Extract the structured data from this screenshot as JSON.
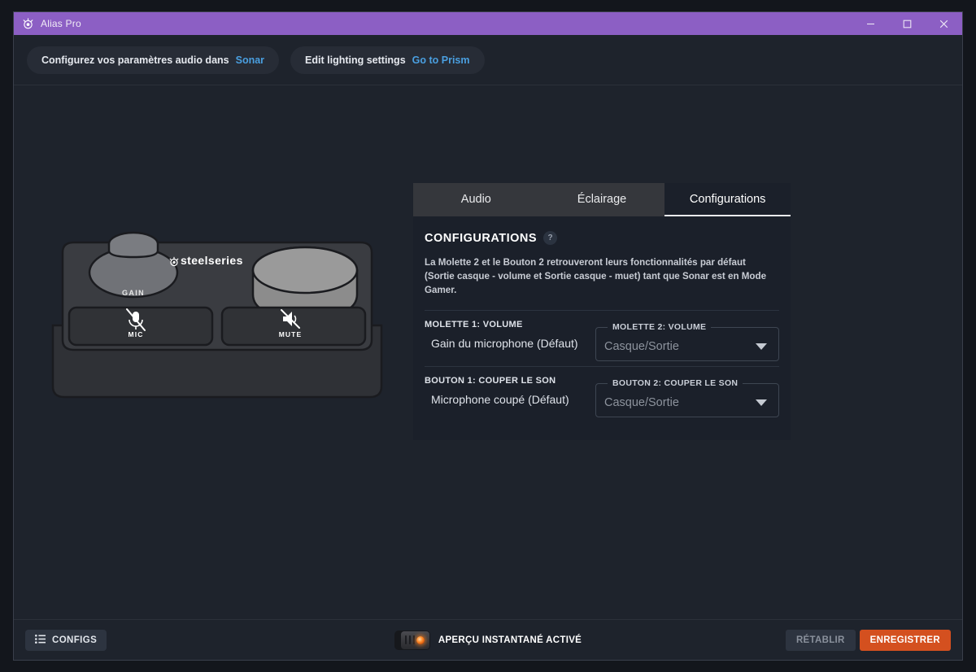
{
  "window": {
    "title": "Alias Pro",
    "logo_icon": "steelseries-logo-icon",
    "titlebar_color": "#8c5fc4",
    "controls": {
      "minimize": "minimize-icon",
      "maximize": "maximize-icon",
      "close": "close-icon"
    }
  },
  "banners": [
    {
      "text": "Configurez vos paramètres audio dans",
      "link": "Sonar"
    },
    {
      "text": "Edit lighting settings",
      "link": "Go to Prism"
    }
  ],
  "device": {
    "brand": "steelseries",
    "knob_label": "GAIN",
    "buttons": [
      {
        "label": "MIC",
        "icon": "mic-muted-icon"
      },
      {
        "label": "MUTE",
        "icon": "speaker-muted-icon"
      }
    ]
  },
  "tabs": [
    {
      "label": "Audio",
      "active": false
    },
    {
      "label": "Éclairage",
      "active": false
    },
    {
      "label": "Configurations",
      "active": true
    }
  ],
  "panel": {
    "section_title": "CONFIGURATIONS",
    "help_badge": "?",
    "description": "La Molette 2 et le Bouton 2 retrouveront leurs fonctionnalités par défaut (Sortie casque - volume et Sortie casque - muet) tant que Sonar est en Mode Gamer.",
    "rows": [
      {
        "left_label": "MOLETTE 1: VOLUME",
        "left_value": "Gain du microphone (Défaut)",
        "right_legend": "MOLETTE 2: VOLUME",
        "right_value": "Casque/Sortie"
      },
      {
        "left_label": "BOUTON 1: COUPER LE SON",
        "left_value": "Microphone coupé (Défaut)",
        "right_legend": "BOUTON 2: COUPER LE SON",
        "right_value": "Casque/Sortie"
      }
    ]
  },
  "footer": {
    "configs_button": "CONFIGS",
    "configs_icon": "list-icon",
    "instant_preview_label": "APERÇU INSTANTANÉ ACTIVÉ",
    "instant_preview_state": "on",
    "reset_button": "RÉTABLIR",
    "save_button": "ENREGISTRER",
    "save_color": "#d4501f"
  }
}
